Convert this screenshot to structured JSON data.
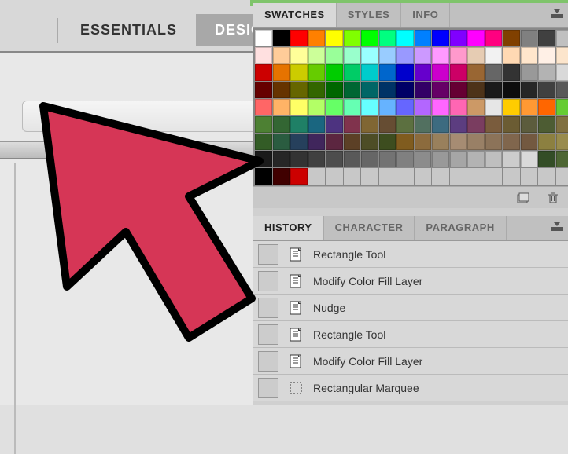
{
  "topbar": {
    "tabs": [
      {
        "label": "ESSENTIALS"
      },
      {
        "label": "DESIGN"
      }
    ]
  },
  "swatch_panel": {
    "tabs": [
      {
        "label": "SWATCHES"
      },
      {
        "label": "STYLES"
      },
      {
        "label": "INFO"
      }
    ],
    "rows": [
      [
        "#ffffff",
        "#000000",
        "#ff0000",
        "#ff8000",
        "#ffff00",
        "#80ff00",
        "#00ff00",
        "#00ff80",
        "#00ffff",
        "#0080ff",
        "#0000ff",
        "#8000ff",
        "#ff00ff",
        "#ff0080",
        "#804000",
        "#808080",
        "#404040",
        "#c0c0c0"
      ],
      [
        "#ffe0e0",
        "#ffcc99",
        "#ffff99",
        "#ccff99",
        "#99ff99",
        "#99ffcc",
        "#99ffff",
        "#99ccff",
        "#9999ff",
        "#cc99ff",
        "#ff99ff",
        "#ff99cc",
        "#e6ccb3",
        "#f2f2f2",
        "#ffd9b3",
        "#ffe6cc",
        "#fff0e6",
        "#fce5cc"
      ],
      [
        "#cc0000",
        "#e67300",
        "#cccc00",
        "#66cc00",
        "#00cc00",
        "#00cc66",
        "#00cccc",
        "#0066cc",
        "#0000cc",
        "#6600cc",
        "#cc00cc",
        "#cc0066",
        "#996633",
        "#666666",
        "#333333",
        "#999999",
        "#b3b3b3",
        "#d9d9d9"
      ],
      [
        "#660000",
        "#663300",
        "#666600",
        "#336600",
        "#006600",
        "#006633",
        "#006666",
        "#003366",
        "#000066",
        "#330066",
        "#660066",
        "#660033",
        "#4d3319",
        "#1a1a1a",
        "#0d0d0d",
        "#262626",
        "#404040",
        "#595959"
      ],
      [
        "#ff6666",
        "#ffb366",
        "#ffff66",
        "#b3ff66",
        "#66ff66",
        "#66ffb3",
        "#66ffff",
        "#66b3ff",
        "#6666ff",
        "#b366ff",
        "#ff66ff",
        "#ff66b3",
        "#cc9966",
        "#e6e6e6",
        "#ffcc00",
        "#ff9933",
        "#ff6600",
        "#66cc33"
      ],
      [
        "#4d8033",
        "#336633",
        "#1f8066",
        "#1a6680",
        "#4d3380",
        "#80334d",
        "#806633",
        "#664d33",
        "#5c7040",
        "#527060",
        "#3d6b80",
        "#5c3d80",
        "#7a3d60",
        "#7a5c3d",
        "#6b5c33",
        "#5c5c3d",
        "#4d5c33",
        "#807040"
      ],
      [
        "#335c26",
        "#2a5c40",
        "#26405c",
        "#40265c",
        "#5c2640",
        "#5c4026",
        "#4d4d26",
        "#3d4d1f",
        "#805c1f",
        "#8c6b3d",
        "#99805c",
        "#a68c73",
        "#998066",
        "#8c7359",
        "#80664d",
        "#735940",
        "#8c8040",
        "#998c4d"
      ],
      [
        "#1a1a1a",
        "#262626",
        "#333333",
        "#404040",
        "#4d4d4d",
        "#595959",
        "#666666",
        "#737373",
        "#808080",
        "#8c8c8c",
        "#999999",
        "#a6a6a6",
        "#b3b3b3",
        "#bfbfbf",
        "#cccccc",
        "#d9d9d9",
        "#334d26",
        "#4d6633"
      ],
      [
        "#000000",
        "#400000",
        "#cc0000",
        "",
        "",
        "",
        "",
        "",
        "",
        "",
        "",
        "",
        "",
        "",
        "",
        "",
        "",
        ""
      ]
    ]
  },
  "history_panel": {
    "tabs": [
      {
        "label": "HISTORY"
      },
      {
        "label": "CHARACTER"
      },
      {
        "label": "PARAGRAPH"
      }
    ],
    "items": [
      {
        "icon": "layer",
        "label": "Rectangle Tool"
      },
      {
        "icon": "layer",
        "label": "Modify Color Fill Layer"
      },
      {
        "icon": "layer",
        "label": "Nudge"
      },
      {
        "icon": "layer",
        "label": "Rectangle Tool"
      },
      {
        "icon": "layer",
        "label": "Modify Color Fill Layer"
      },
      {
        "icon": "marquee",
        "label": "Rectangular Marquee"
      }
    ]
  }
}
